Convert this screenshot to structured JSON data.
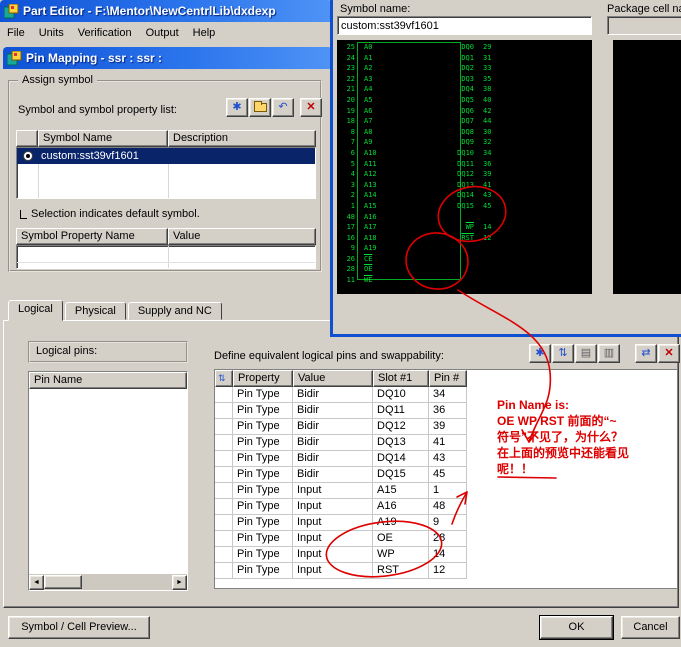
{
  "main_window": {
    "title": "Part Editor - F:\\Mentor\\NewCentrlLib\\dxdexp",
    "menu": [
      "File",
      "Units",
      "Verification",
      "Output",
      "Help"
    ]
  },
  "dialog": {
    "title": "Pin Mapping - ssr : ssr :",
    "assign_symbol": {
      "label": "Assign symbol",
      "list_label": "Symbol and symbol property list:",
      "symbol_table": {
        "headers": {
          "name": "Symbol Name",
          "description": "Description"
        },
        "rows": [
          {
            "name": "custom:sst39vf1601",
            "description": ""
          }
        ]
      },
      "note": "Selection indicates default symbol.",
      "property_table": {
        "headers": {
          "name": "Symbol Property Name",
          "value": "Value"
        }
      }
    },
    "tabs": [
      {
        "label": "Logical",
        "cls": "active"
      },
      {
        "label": "Physical",
        "cls": ""
      },
      {
        "label": "Supply and NC",
        "cls": ""
      }
    ],
    "logical_pins": {
      "label": "Logical pins:",
      "column_header": "Pin Name"
    },
    "equivalent": {
      "label": "Define equivalent logical pins and swappability:",
      "headers": {
        "property": "Property",
        "value": "Value",
        "slot": "Slot #1",
        "pin": "Pin #"
      },
      "rows": [
        {
          "property": "Pin Type",
          "value": "Bidir",
          "slot": "DQ10",
          "pin": "34"
        },
        {
          "property": "Pin Type",
          "value": "Bidir",
          "slot": "DQ11",
          "pin": "36"
        },
        {
          "property": "Pin Type",
          "value": "Bidir",
          "slot": "DQ12",
          "pin": "39"
        },
        {
          "property": "Pin Type",
          "value": "Bidir",
          "slot": "DQ13",
          "pin": "41"
        },
        {
          "property": "Pin Type",
          "value": "Bidir",
          "slot": "DQ14",
          "pin": "43"
        },
        {
          "property": "Pin Type",
          "value": "Bidir",
          "slot": "DQ15",
          "pin": "45"
        },
        {
          "property": "Pin Type",
          "value": "Input",
          "slot": "A15",
          "pin": "1"
        },
        {
          "property": "Pin Type",
          "value": "Input",
          "slot": "A16",
          "pin": "48"
        },
        {
          "property": "Pin Type",
          "value": "Input",
          "slot": "A19",
          "pin": "9"
        },
        {
          "property": "Pin Type",
          "value": "Input",
          "slot": "OE",
          "pin": "28"
        },
        {
          "property": "Pin Type",
          "value": "Input",
          "slot": "WP",
          "pin": "14"
        },
        {
          "property": "Pin Type",
          "value": "Input",
          "slot": "RST",
          "pin": "12"
        }
      ]
    },
    "buttons": {
      "preview": "Symbol / Cell Preview...",
      "ok": "OK",
      "cancel": "Cancel"
    }
  },
  "preview_window": {
    "symbol_label": "Symbol name:",
    "symbol_value": "custom:sst39vf1601",
    "package_label": "Package cell na",
    "pin_rows": [
      {
        "ln": "25",
        "lnm": "A0",
        "lcls": "",
        "rnm": "DQ0",
        "rcls": "",
        "rn": "29"
      },
      {
        "ln": "24",
        "lnm": "A1",
        "lcls": "",
        "rnm": "DQ1",
        "rcls": "",
        "rn": "31"
      },
      {
        "ln": "23",
        "lnm": "A2",
        "lcls": "",
        "rnm": "DQ2",
        "rcls": "",
        "rn": "33"
      },
      {
        "ln": "22",
        "lnm": "A3",
        "lcls": "",
        "rnm": "DQ3",
        "rcls": "",
        "rn": "35"
      },
      {
        "ln": "21",
        "lnm": "A4",
        "lcls": "",
        "rnm": "DQ4",
        "rcls": "",
        "rn": "38"
      },
      {
        "ln": "20",
        "lnm": "A5",
        "lcls": "",
        "rnm": "DQ5",
        "rcls": "",
        "rn": "40"
      },
      {
        "ln": "19",
        "lnm": "A6",
        "lcls": "",
        "rnm": "DQ6",
        "rcls": "",
        "rn": "42"
      },
      {
        "ln": "18",
        "lnm": "A7",
        "lcls": "",
        "rnm": "DQ7",
        "rcls": "",
        "rn": "44"
      },
      {
        "ln": "8",
        "lnm": "A8",
        "lcls": "",
        "rnm": "DQ8",
        "rcls": "",
        "rn": "30"
      },
      {
        "ln": "7",
        "lnm": "A9",
        "lcls": "",
        "rnm": "DQ9",
        "rcls": "",
        "rn": "32"
      },
      {
        "ln": "6",
        "lnm": "A10",
        "lcls": "",
        "rnm": "DQ10",
        "rcls": "",
        "rn": "34"
      },
      {
        "ln": "5",
        "lnm": "A11",
        "lcls": "",
        "rnm": "DQ11",
        "rcls": "",
        "rn": "36"
      },
      {
        "ln": "4",
        "lnm": "A12",
        "lcls": "",
        "rnm": "DQ12",
        "rcls": "",
        "rn": "39"
      },
      {
        "ln": "3",
        "lnm": "A13",
        "lcls": "",
        "rnm": "DQ13",
        "rcls": "",
        "rn": "41"
      },
      {
        "ln": "2",
        "lnm": "A14",
        "lcls": "",
        "rnm": "DQ14",
        "rcls": "",
        "rn": "43"
      },
      {
        "ln": "1",
        "lnm": "A15",
        "lcls": "",
        "rnm": "DQ15",
        "rcls": "",
        "rn": "45"
      },
      {
        "ln": "48",
        "lnm": "A16",
        "lcls": "",
        "rnm": "",
        "rcls": "",
        "rn": ""
      },
      {
        "ln": "17",
        "lnm": "A17",
        "lcls": "",
        "rnm": "WP",
        "rcls": "ov",
        "rn": "14"
      },
      {
        "ln": "16",
        "lnm": "A18",
        "lcls": "",
        "rnm": "RST",
        "rcls": "ov",
        "rn": "12"
      },
      {
        "ln": "9",
        "lnm": "A19",
        "lcls": "",
        "rnm": "",
        "rcls": "",
        "rn": ""
      },
      {
        "ln": "26",
        "lnm": "CE",
        "lcls": "ov",
        "rnm": "",
        "rcls": "",
        "rn": ""
      },
      {
        "ln": "28",
        "lnm": "OE",
        "lcls": "ov",
        "rnm": "",
        "rcls": "",
        "rn": ""
      },
      {
        "ln": "11",
        "lnm": "WE",
        "lcls": "ov",
        "rnm": "",
        "rcls": "",
        "rn": ""
      }
    ]
  },
  "icons": {
    "new": "✱",
    "undo": "↶",
    "delete": "✕",
    "equiv_new": "✱",
    "swap": "⇅",
    "copy": "▤",
    "paste": "▥",
    "swap_pair": "⇄",
    "remove": "✕",
    "grid": "▦",
    "swap_col": "⇅",
    "scroll_left": "◄",
    "scroll_right": "►"
  },
  "annotation": {
    "color": "#dd0000",
    "lines": [
      "Pin Name is:",
      "OE WP RST  前面的“~",
      "符号”不见了，为什么？",
      "在上面的预览中还能看见",
      "呢！！"
    ]
  }
}
